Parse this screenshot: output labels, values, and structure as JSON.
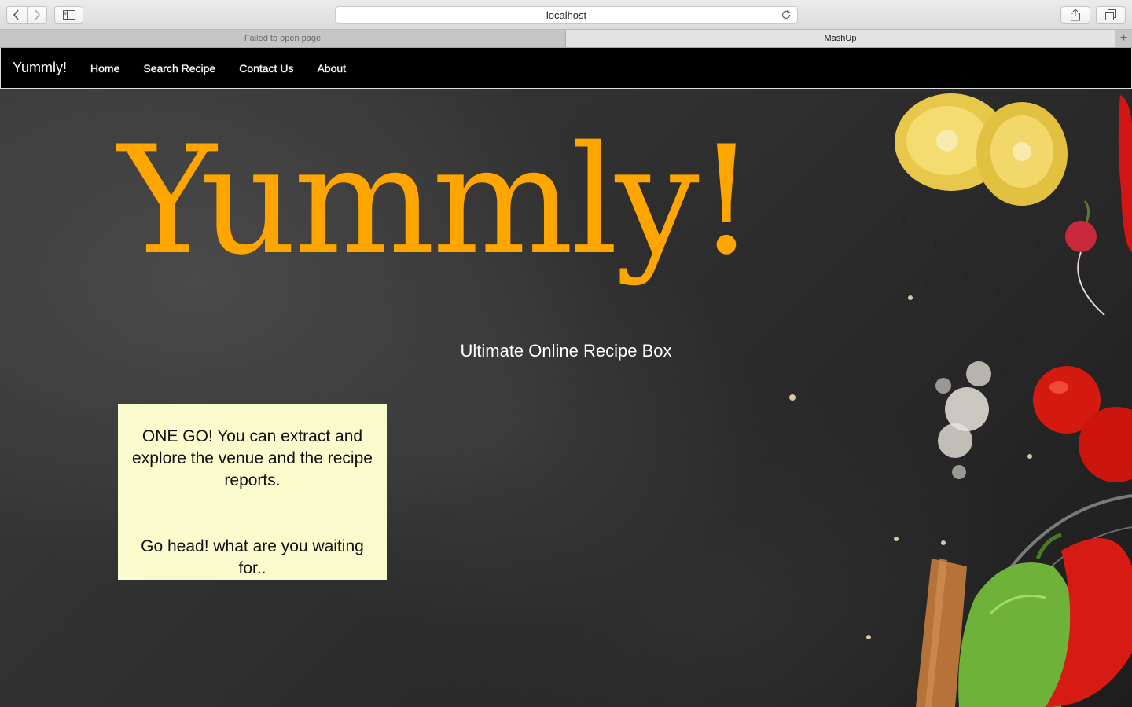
{
  "browser": {
    "address": "localhost",
    "tabs": [
      {
        "label": "Failed to open page",
        "active": false
      },
      {
        "label": "MashUp",
        "active": true
      }
    ],
    "new_tab_label": "+"
  },
  "navbar": {
    "brand": "Yummly!",
    "links": [
      "Home",
      "Search Recipe",
      "Contact Us",
      "About"
    ]
  },
  "hero": {
    "title": "Yummly!",
    "subtitle": "Ultimate Online Recipe Box"
  },
  "info_box": {
    "paragraph_1": "ONE GO! You can extract and explore the venue and the recipe reports.",
    "paragraph_2": "Go head! what are you waiting for.."
  },
  "colors": {
    "title": "#ffa500",
    "navbar_bg": "#000000",
    "info_box_bg": "#fafbcc"
  }
}
